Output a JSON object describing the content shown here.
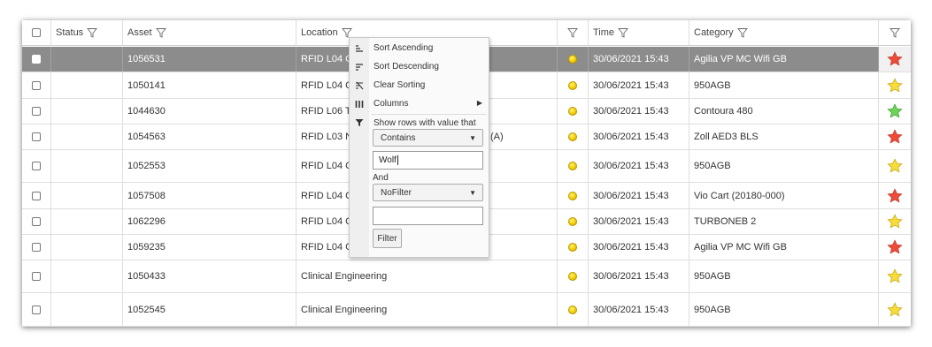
{
  "header": {
    "status": "Status",
    "asset": "Asset",
    "location": "Location",
    "time": "Time",
    "category": "Category"
  },
  "rows": [
    {
      "asset": "1056531",
      "location": "RFID L04 C",
      "time": "30/06/2021 15:43",
      "category": "Agilia VP MC Wifi GB",
      "star": "red"
    },
    {
      "asset": "1050141",
      "location": "RFID L04 C",
      "time": "30/06/2021 15:43",
      "category": "950AGB",
      "star": "yellow"
    },
    {
      "asset": "1044630",
      "location": "RFID L06 T",
      "time": "30/06/2021 15:43",
      "category": "Contoura 480",
      "star": "green"
    },
    {
      "asset": "1054563",
      "location": "RFID L03 N",
      "location_tail": "(A)",
      "time": "30/06/2021 15:43",
      "category": "Zoll AED3 BLS",
      "star": "red"
    },
    {
      "asset": "1052553",
      "location": "RFID L04 C",
      "time": "30/06/2021 15:43",
      "category": "950AGB",
      "star": "yellow"
    },
    {
      "asset": "1057508",
      "location": "RFID L04 C",
      "time": "30/06/2021 15:43",
      "category": "Vio Cart (20180-000)",
      "star": "red"
    },
    {
      "asset": "1062296",
      "location": "RFID L04 C",
      "time": "30/06/2021 15:43",
      "category": "TURBONEB 2",
      "star": "yellow"
    },
    {
      "asset": "1059235",
      "location": "RFID L04 C",
      "time": "30/06/2021 15:43",
      "category": "Agilia VP MC Wifi GB",
      "star": "red"
    },
    {
      "asset": "1050433",
      "location": "Clinical Engineering",
      "time": "30/06/2021 15:43",
      "category": "950AGB",
      "star": "yellow"
    },
    {
      "asset": "1052545",
      "location": "Clinical Engineering",
      "time": "30/06/2021 15:43",
      "category": "950AGB",
      "star": "yellow"
    }
  ],
  "menu": {
    "sort_asc": "Sort Ascending",
    "sort_desc": "Sort Descending",
    "clear_sort": "Clear Sorting",
    "columns": "Columns",
    "show_rows": "Show rows with value that",
    "condition1": "Contains",
    "value1": "Wolf",
    "and_label": "And",
    "condition2": "NoFilter",
    "value2": "",
    "filter_button": "Filter"
  },
  "colors": {
    "selected_row": "#8c8c8c",
    "indicator": "#f3cd00",
    "star_red": "#ee4b38",
    "star_yellow": "#f7dc3c",
    "star_green": "#6fd35a"
  }
}
